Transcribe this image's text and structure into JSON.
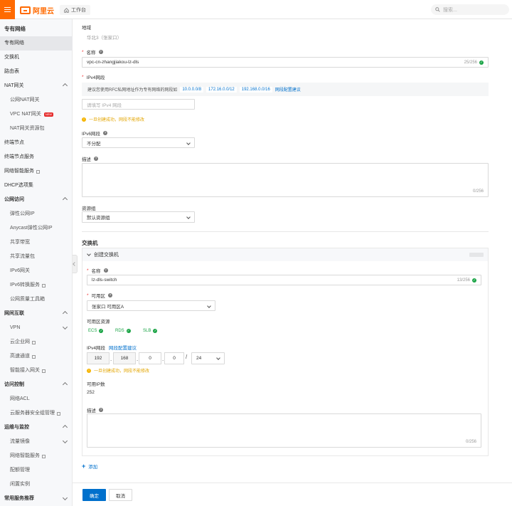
{
  "topbar": {
    "logo_text": "阿里云",
    "workbench_label": "工作台",
    "search_placeholder": "搜索..."
  },
  "sidebar": {
    "title": "专有网络",
    "items": [
      {
        "label": "专有网络",
        "level": "top",
        "active": true
      },
      {
        "label": "交换机",
        "level": "top"
      },
      {
        "label": "路由表",
        "level": "top"
      },
      {
        "label": "NAT网关",
        "level": "top",
        "expandable": true
      },
      {
        "label": "公网NAT网关",
        "level": "sub"
      },
      {
        "label": "VPC NAT网关",
        "level": "sub",
        "badge": "NEW"
      },
      {
        "label": "NAT网关资源包",
        "level": "sub"
      },
      {
        "label": "终端节点",
        "level": "top"
      },
      {
        "label": "终端节点服务",
        "level": "top"
      },
      {
        "label": "网络智能服务",
        "level": "top",
        "external": true
      },
      {
        "label": "DHCP选项集",
        "level": "top"
      },
      {
        "label": "公网访问",
        "level": "group",
        "expandable": true
      },
      {
        "label": "弹性公网IP",
        "level": "sub"
      },
      {
        "label": "Anycast弹性公网IP",
        "level": "sub"
      },
      {
        "label": "共享带宽",
        "level": "sub"
      },
      {
        "label": "共享流量包",
        "level": "sub"
      },
      {
        "label": "IPv6网关",
        "level": "sub"
      },
      {
        "label": "IPv6转换服务",
        "level": "sub",
        "external": true
      },
      {
        "label": "公网质量工具箱",
        "level": "sub"
      },
      {
        "label": "网间互联",
        "level": "group",
        "expandable": true
      },
      {
        "label": "VPN",
        "level": "sub",
        "expandable": true,
        "collapsed": true
      },
      {
        "label": "云企业网",
        "level": "sub",
        "external": true
      },
      {
        "label": "高速通道",
        "level": "sub",
        "external": true
      },
      {
        "label": "智能接入网关",
        "level": "sub",
        "external": true
      },
      {
        "label": "访问控制",
        "level": "group",
        "expandable": true
      },
      {
        "label": "网络ACL",
        "level": "sub"
      },
      {
        "label": "云服务器安全组管理",
        "level": "sub",
        "external": true
      },
      {
        "label": "运维与监控",
        "level": "group",
        "expandable": true
      },
      {
        "label": "流量镜像",
        "level": "sub",
        "expandable": true,
        "collapsed": true
      },
      {
        "label": "网络智能服务",
        "level": "sub",
        "external": true
      },
      {
        "label": "配额管理",
        "level": "sub"
      },
      {
        "label": "闲置实例",
        "level": "sub"
      },
      {
        "label": "常用服务推荐",
        "level": "group",
        "expandable": true,
        "collapsed": true
      }
    ]
  },
  "form": {
    "region_label": "地域",
    "region_value": "华北3（张家口）",
    "name_label": "名称",
    "name_value": "vpc-cn-zhangjiakou-lz-dls",
    "name_count": "25/256",
    "ipv4_label": "IPv4网段",
    "ipv4_hint_prefix": "建议您使用RFC私网地址作为专有网络的网段如",
    "ipv4_hint_tags": [
      "10.0.0.0/8",
      "172.16.0.0/12",
      "192.168.0.0/16"
    ],
    "ipv4_hint_link": "网段配置建议",
    "ipv4_placeholder": "请填写 IPv4 网段",
    "ipv4_tip": "一旦创建成功，网段不能修改",
    "ipv6_label": "IPv6网段",
    "ipv6_value": "不分配",
    "desc_label": "描述",
    "desc_count": "0/256",
    "rg_label": "资源组",
    "rg_value": "默认资源组"
  },
  "vswitch": {
    "section_title": "交换机",
    "card_title": "创建交换机",
    "name_label": "名称",
    "name_value": "lz-dls-switch",
    "name_count": "13/256",
    "zone_label": "可用区",
    "zone_value": "张家口 可用区A",
    "zone_resources_label": "可用区资源",
    "resources": [
      "ECS",
      "RDS",
      "SLB"
    ],
    "ipv4_label": "IPv4网段",
    "ipv4_link": "网段配置建议",
    "ip_segments": [
      "192",
      "168",
      "0",
      "0"
    ],
    "mask": "24",
    "ipv4_tip": "一旦创建成功，网段不能修改",
    "available_ip_label": "可用IP数",
    "available_ip_value": "252",
    "desc_label": "描述",
    "desc_count": "0/256",
    "add_label": "添加"
  },
  "footer": {
    "confirm_label": "确定",
    "cancel_label": "取消"
  }
}
